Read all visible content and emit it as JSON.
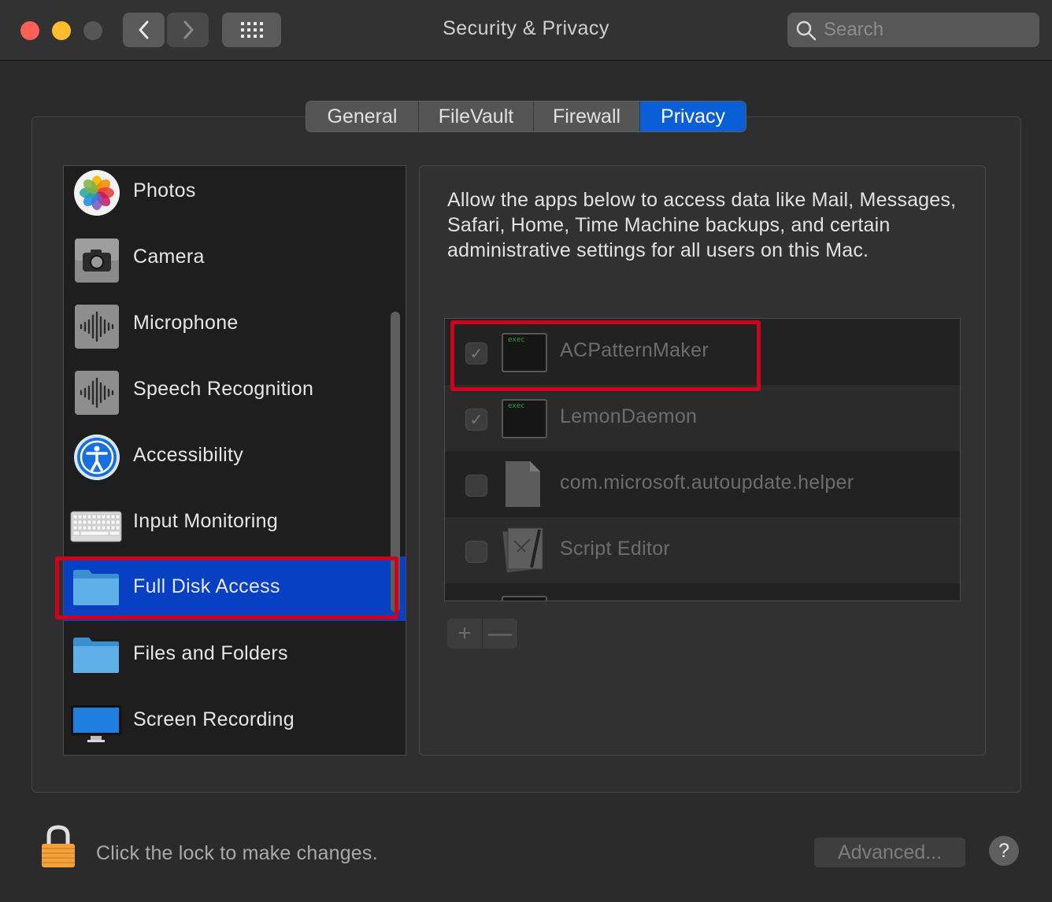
{
  "window": {
    "title": "Security & Privacy",
    "search_placeholder": "Search"
  },
  "tabs": [
    {
      "label": "General"
    },
    {
      "label": "FileVault"
    },
    {
      "label": "Firewall"
    },
    {
      "label": "Privacy",
      "active": true
    }
  ],
  "sidebar": {
    "items": [
      {
        "label": "Photos",
        "icon": "photos-icon"
      },
      {
        "label": "Camera",
        "icon": "camera-icon"
      },
      {
        "label": "Microphone",
        "icon": "microphone-icon"
      },
      {
        "label": "Speech Recognition",
        "icon": "speech-recognition-icon"
      },
      {
        "label": "Accessibility",
        "icon": "accessibility-icon"
      },
      {
        "label": "Input Monitoring",
        "icon": "keyboard-icon"
      },
      {
        "label": "Full Disk Access",
        "icon": "folder-icon",
        "selected": true
      },
      {
        "label": "Files and Folders",
        "icon": "folder-icon"
      },
      {
        "label": "Screen Recording",
        "icon": "display-icon"
      }
    ]
  },
  "panel": {
    "description": "Allow the apps below to access data like Mail, Messages, Safari, Home, Time Machine backups, and certain administrative settings for all users on this Mac.",
    "apps": [
      {
        "name": "ACPatternMaker",
        "checked": true,
        "icon": "exec-icon",
        "icon_text": "exec"
      },
      {
        "name": "LemonDaemon",
        "checked": true,
        "icon": "exec-icon",
        "icon_text": "exec"
      },
      {
        "name": "com.microsoft.autoupdate.helper",
        "checked": false,
        "icon": "document-icon"
      },
      {
        "name": "Script Editor",
        "checked": false,
        "icon": "script-editor-icon"
      }
    ],
    "add_label": "+",
    "remove_label": "—"
  },
  "footer": {
    "lock_text": "Click the lock to make changes.",
    "advanced_label": "Advanced...",
    "help_label": "?"
  },
  "colors": {
    "accent": "#0a5fd6",
    "selection": "#0840c4",
    "highlight": "#d0021b"
  }
}
